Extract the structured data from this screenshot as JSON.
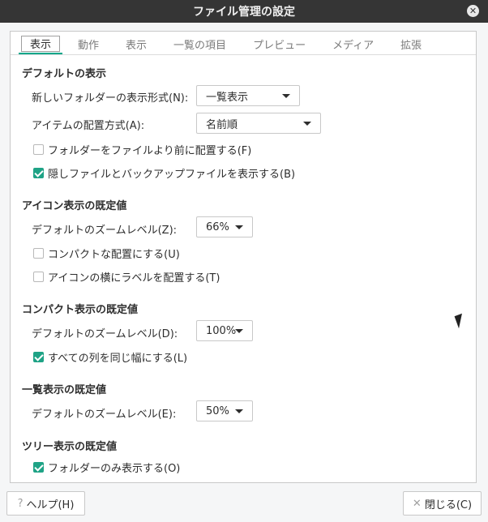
{
  "window": {
    "title": "ファイル管理の設定"
  },
  "tabs": [
    {
      "label": "表示",
      "active": true
    },
    {
      "label": "動作"
    },
    {
      "label": "表示"
    },
    {
      "label": "一覧の項目"
    },
    {
      "label": "プレビュー"
    },
    {
      "label": "メディア"
    },
    {
      "label": "拡張"
    }
  ],
  "sections": {
    "default_view": {
      "title": "デフォルトの表示",
      "new_folder_label": "新しいフォルダーの表示形式(N):",
      "new_folder_value": "一覧表示",
      "arrange_label": "アイテムの配置方式(A):",
      "arrange_value": "名前順",
      "folders_first": {
        "label": "フォルダーをファイルより前に配置する(F)",
        "checked": false
      },
      "show_hidden": {
        "label": "隠しファイルとバックアップファイルを表示する(B)",
        "checked": true
      }
    },
    "icon_view": {
      "title": "アイコン表示の既定値",
      "zoom_label": "デフォルトのズームレベル(Z):",
      "zoom_value": "66%",
      "compact": {
        "label": "コンパクトな配置にする(U)",
        "checked": false
      },
      "label_beside": {
        "label": "アイコンの横にラベルを配置する(T)",
        "checked": false
      }
    },
    "compact_view": {
      "title": "コンパクト表示の既定値",
      "zoom_label": "デフォルトのズームレベル(D):",
      "zoom_value": "100%",
      "same_width": {
        "label": "すべての列を同じ幅にする(L)",
        "checked": true
      }
    },
    "list_view": {
      "title": "一覧表示の既定値",
      "zoom_label": "デフォルトのズームレベル(E):",
      "zoom_value": "50%"
    },
    "tree_view": {
      "title": "ツリー表示の既定値",
      "folders_only": {
        "label": "フォルダーのみ表示する(O)",
        "checked": true
      }
    }
  },
  "buttons": {
    "help_label": "ヘルプ(H)",
    "close_label": "閉じる(C)"
  },
  "icons": {
    "help": "question-mark-icon",
    "close": "x-icon",
    "window_close": "window-close-icon"
  },
  "colors": {
    "accent": "#1fa386",
    "titlebar": "#353535"
  }
}
